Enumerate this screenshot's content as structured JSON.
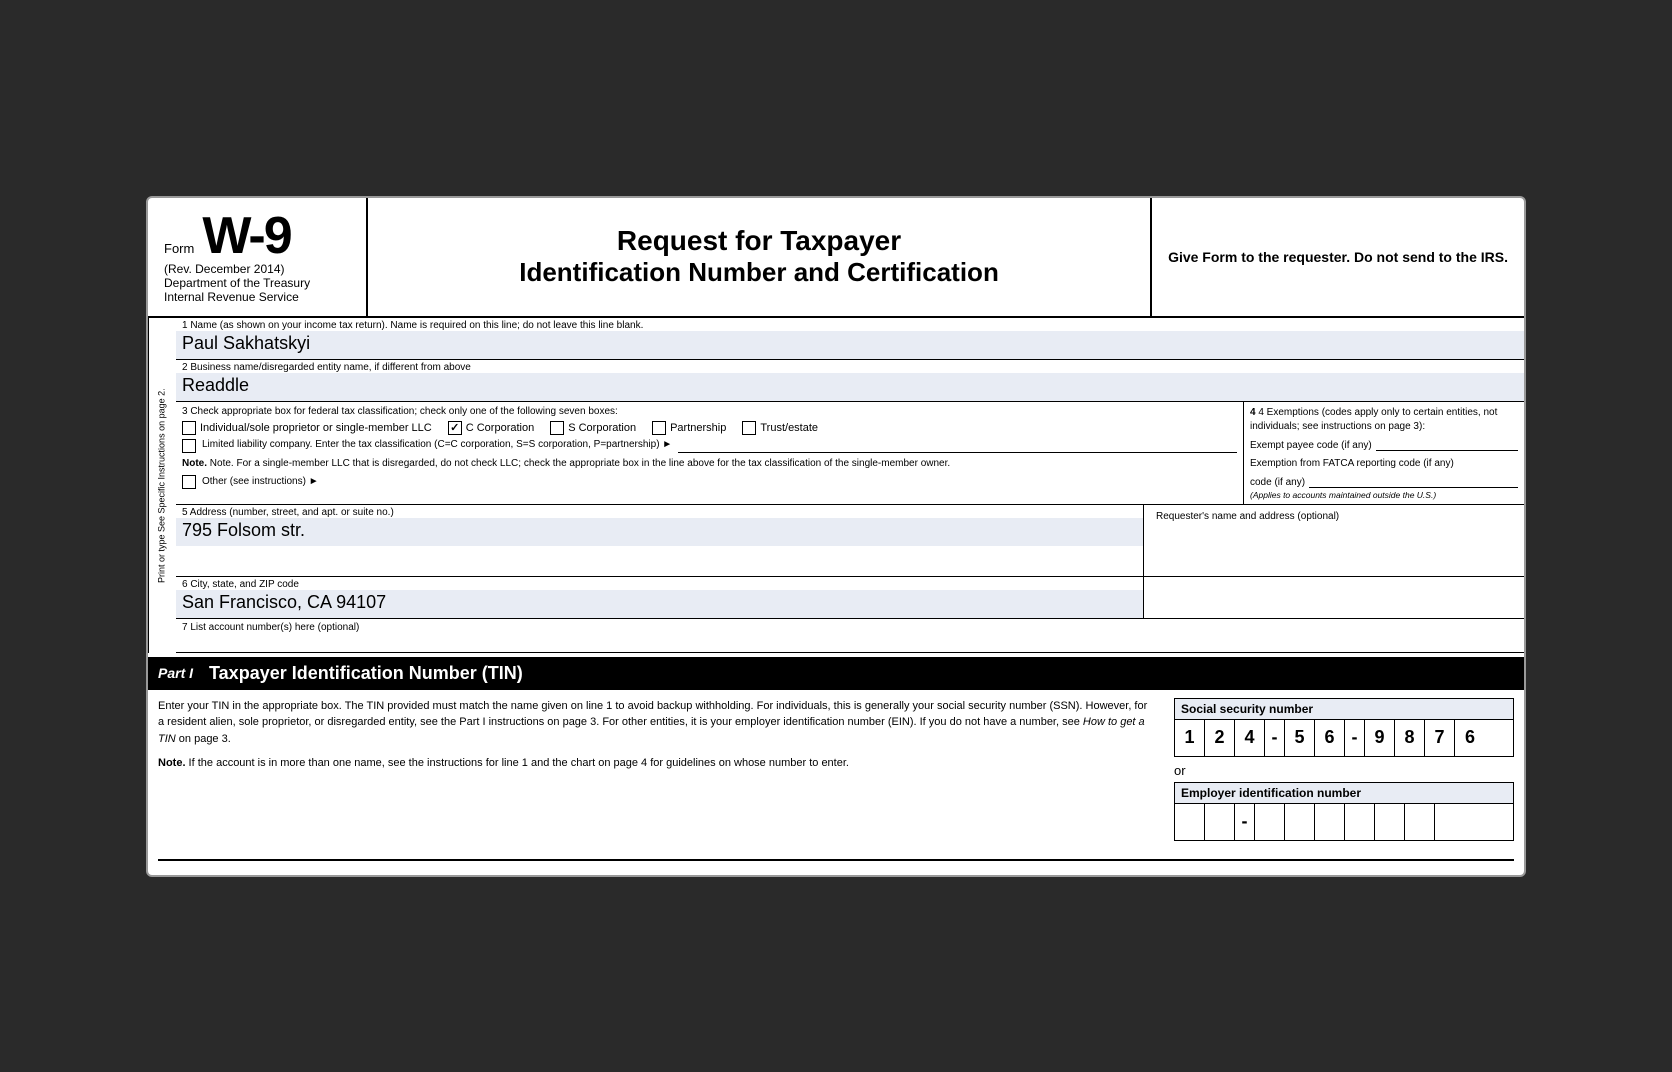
{
  "header": {
    "form_prefix": "Form",
    "form_number": "W-9",
    "rev_date": "(Rev. December 2014)",
    "department": "Department of the Treasury",
    "irs": "Internal Revenue Service",
    "title_line1": "Request for Taxpayer",
    "title_line2": "Identification Number and Certification",
    "instructions": "Give Form to the requester. Do not send to the IRS."
  },
  "sidebar": {
    "text": "Print or type     See Specific Instructions on page 2."
  },
  "fields": {
    "field1_label": "1  Name (as shown on your income tax return). Name is required on this line; do not leave this line blank.",
    "field1_value": "Paul Sakhatskyi",
    "field2_label": "2  Business name/disregarded entity name, if different from above",
    "field2_value": "Readdle",
    "field3_label": "3  Check appropriate box for federal tax classification; check only one of the following seven boxes:",
    "checkbox_individual": "Individual/sole proprietor or single-member LLC",
    "checkbox_c_corp": "C Corporation",
    "checkbox_s_corp": "S Corporation",
    "checkbox_partnership": "Partnership",
    "checkbox_trust": "Trust/estate",
    "checkbox_llc_label": "Limited liability company. Enter the tax classification (C=C corporation, S=S corporation, P=partnership) ►",
    "note_text": "Note. For a single-member LLC that is disregarded, do not check LLC; check the appropriate box in the line above for the tax classification of the single-member owner.",
    "other_label": "Other (see instructions) ►",
    "field4_label": "4  Exemptions (codes apply only to certain entities, not individuals; see instructions on page 3):",
    "exempt_payee_label": "Exempt payee code (if any)",
    "fatca_label": "Exemption from FATCA reporting code (if any)",
    "applies_note": "(Applies to accounts maintained outside the U.S.)",
    "field5_label": "5  Address (number, street, and apt. or suite no.)",
    "field5_value": "795 Folsom str.",
    "requester_label": "Requester's name and address (optional)",
    "field6_label": "6  City, state, and ZIP code",
    "field6_value": "San Francisco, CA 94107",
    "field7_label": "7  List account number(s) here (optional)"
  },
  "part1": {
    "label": "Part I",
    "title": "Taxpayer Identification Number (TIN)",
    "description_p1": "Enter your TIN in the appropriate box. The TIN provided must match the name given on line 1 to avoid backup withholding. For individuals, this is generally your social security number (SSN). However, for a resident alien, sole proprietor, or disregarded entity, see the Part I instructions on page 3. For other entities, it is your employer identification number (EIN). If you do not have a number, see ",
    "description_italic": "How to get a TIN",
    "description_p2": " on page 3.",
    "note_label": "Note.",
    "note_text": " If the account is in more than one name, see the instructions for line 1 and the chart on page 4 for guidelines on whose number to enter.",
    "ssn_label": "Social security number",
    "ssn_digits": [
      "1",
      "2",
      "4",
      "",
      "5",
      "6",
      "",
      "9",
      "8",
      "7",
      "6"
    ],
    "ssn_values": {
      "d1": "1",
      "d2": "2",
      "d3": "4",
      "d4": "5",
      "d5": "6",
      "d6": "9",
      "d7": "8",
      "d8": "7",
      "d9": "6"
    },
    "or_text": "or",
    "ein_label": "Employer identification number",
    "ein_cells": [
      "",
      "",
      "",
      "",
      "",
      "",
      "",
      "",
      ""
    ]
  }
}
